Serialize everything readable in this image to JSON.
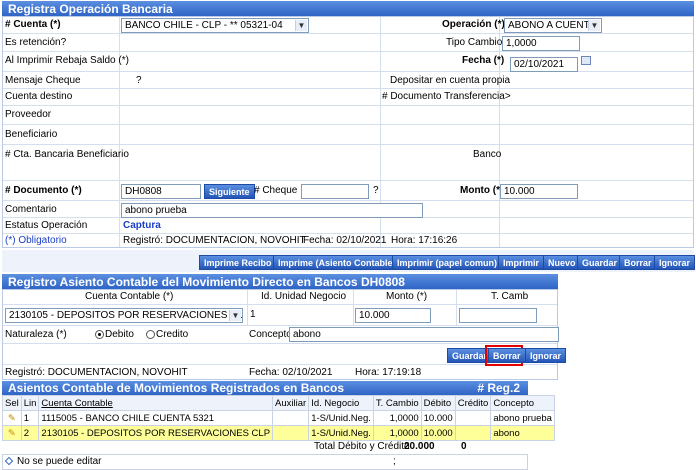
{
  "form": {
    "title": "Registra Operación Bancaria",
    "cuenta_label": "# Cuenta (*)",
    "cuenta_value": "BANCO CHILE - CLP - ** 05321-04",
    "operacion_label": "Operación (*)",
    "operacion_value": "ABONO A CUENTA",
    "es_retencion_label": "Es retención?",
    "tipo_cambio_label": "Tipo Cambio",
    "tipo_cambio_value": "1,0000",
    "al_imprimir_label": "Al Imprimir Rebaja Saldo (*)",
    "fecha_label": "Fecha (*)",
    "fecha_value": "02/10/2021",
    "mensaje_cheque_label": "Mensaje Cheque",
    "mensaje_cheque_help": "?",
    "depositar_label": "Depositar en cuenta propia",
    "cuenta_destino_label": "Cuenta destino",
    "doc_transferencia_label": "# Documento Transferencia>",
    "proveedor_label": "Proveedor",
    "beneficiario_label": "Beneficiario",
    "cta_bancaria_label": "# Cta. Bancaria Beneficiario",
    "banco_label": "Banco",
    "documento_label": "# Documento (*)",
    "documento_value": "DH0808",
    "siguiente_label": "Siguiente",
    "cheque_label": "# Cheque",
    "cheque_help": "?",
    "monto_label": "Monto (*)",
    "monto_value": "10.000",
    "comentario_label": "Comentario",
    "comentario_value": "abono prueba",
    "estatus_label": "Estatus Operación",
    "estatus_value": "Captura",
    "obligatorio_label": "(*) Obligatorio",
    "registro_text": "Registró: DOCUMENTACION, NOVOHIT",
    "fecha_registro_text": "Fecha: 02/10/2021",
    "hora_registro_text": "Hora: 17:16:26"
  },
  "toolbar1": {
    "imprimir_recibo": "Imprime Recibo",
    "imprime_asiento": "Imprime (Asiento Contable)",
    "imprimir_papel": "Imprimir (papel comun)",
    "imprimir": "Imprimir",
    "nuevo": "Nuevo",
    "guardar": "Guardar",
    "borrar": "Borrar",
    "ignorar": "Ignorar"
  },
  "asiento": {
    "title": "Registro Asiento Contable del Movimiento Directo en Bancos DH0808",
    "col_cuenta": "Cuenta Contable (*)",
    "col_unidad": "Id. Unidad Negocio",
    "col_monto": "Monto (*)",
    "col_tcamb": "T. Camb",
    "cuenta_value": "2130105 - DEPOSITOS POR RESERVACIONES CLP",
    "unidad_value": "1",
    "monto_value": "10.000",
    "tcamb_value": "",
    "naturaleza_label": "Naturaleza (*)",
    "debito_label": "Debito",
    "credito_label": "Credito",
    "concepto_label": "Concepto",
    "concepto_value": "abono",
    "guardar": "Guardar",
    "borrar": "Borrar",
    "ignorar": "Ignorar",
    "registro_text": "Registró: DOCUMENTACION, NOVOHIT",
    "fecha_text": "Fecha: 02/10/2021",
    "hora_text": "Hora:  17:19:18"
  },
  "movimientos": {
    "title": "Asientos Contable de Movimientos Registrados en Bancos",
    "reg_count": "# Reg.2",
    "headers": [
      "Sel",
      "Lin",
      "Cuenta Contable",
      "Auxiliar",
      "Id. Negocio",
      "T. Cambio",
      "Débito",
      "Crédito",
      "Concepto"
    ],
    "rows": [
      {
        "lin": "1",
        "cuenta": "1115005 - BANCO CHILE CUENTA 5321",
        "auxiliar": "",
        "negocio": "1-S/Unid.Neg.",
        "tcambio": "1,0000",
        "debito": "10.000",
        "credito": "",
        "concepto": "abono prueba"
      },
      {
        "lin": "2",
        "cuenta": "2130105 - DEPOSITOS POR RESERVACIONES CLP",
        "auxiliar": "",
        "negocio": "1-S/Unid.Neg.",
        "tcambio": "1,0000",
        "debito": "10.000",
        "credito": "",
        "concepto": "abono"
      }
    ],
    "total_label": "Total Débito y Crédito",
    "total_debito": "20.000",
    "total_credito": "0",
    "footer_text": "No se puede editar",
    "footer_sep": ";"
  },
  "colors": {
    "header_blue": "#2f64c6",
    "highlight_row": "#ffff99",
    "button_blue": "#2456b8",
    "focus_red": "#e00000"
  }
}
